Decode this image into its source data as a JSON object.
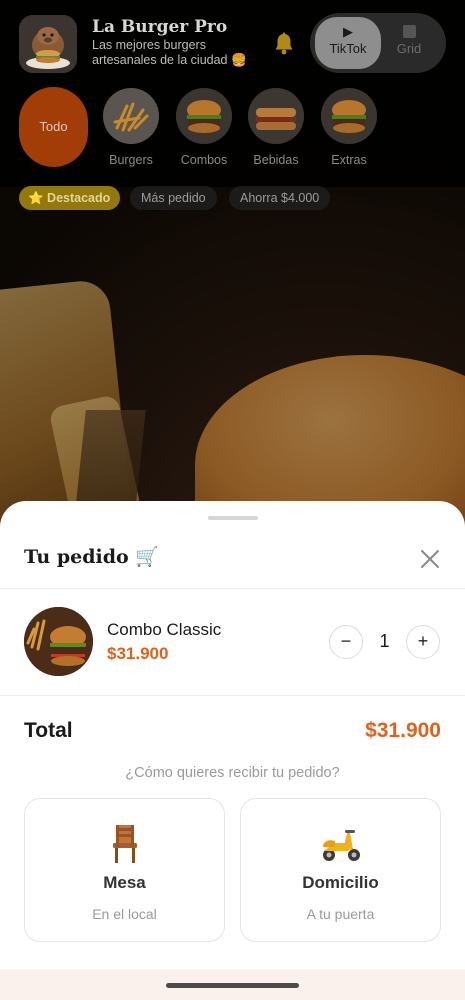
{
  "header": {
    "brand_name": "La Burger Pro",
    "tagline": "Las mejores burgers artesanales de la ciudad 🍔",
    "icons": {
      "logo": "capybara-burger-logo",
      "notifications": "bell-icon"
    }
  },
  "view_toggle": {
    "options": [
      {
        "label": "TikTok",
        "icon": "play-icon",
        "active": true
      },
      {
        "label": "Grid",
        "icon": "grid-icon",
        "active": false
      }
    ]
  },
  "categories": [
    {
      "label": "Todo",
      "active": true
    },
    {
      "label": "Burgers",
      "icon": "fries-thumb"
    },
    {
      "label": "Combos",
      "icon": "burger-thumb"
    },
    {
      "label": "Bebidas",
      "icon": "sandwich-thumb"
    },
    {
      "label": "Extras",
      "icon": "burger-thumb"
    }
  ],
  "badges": {
    "featured": "⭐ Destacado",
    "popular": "Más pedido",
    "savings": "Ahorra $4.000"
  },
  "order_sheet": {
    "title": "Tu pedido 🛒",
    "close_icon": "close-icon",
    "items": [
      {
        "name": "Combo Classic",
        "price": "$31.900",
        "quantity": "1",
        "minus": "−",
        "plus": "+"
      }
    ],
    "total_label": "Total",
    "total_value": "$31.900",
    "question": "¿Cómo quieres recibir tu pedido?",
    "options": [
      {
        "title": "Mesa",
        "subtitle": "En el local",
        "icon": "chair-icon"
      },
      {
        "title": "Domicilio",
        "subtitle": "A tu puerta",
        "icon": "scooter-icon"
      }
    ]
  },
  "colors": {
    "accent": "#e0621c",
    "todo_pill": "#a33d07",
    "featured_badge": "#93780e"
  }
}
